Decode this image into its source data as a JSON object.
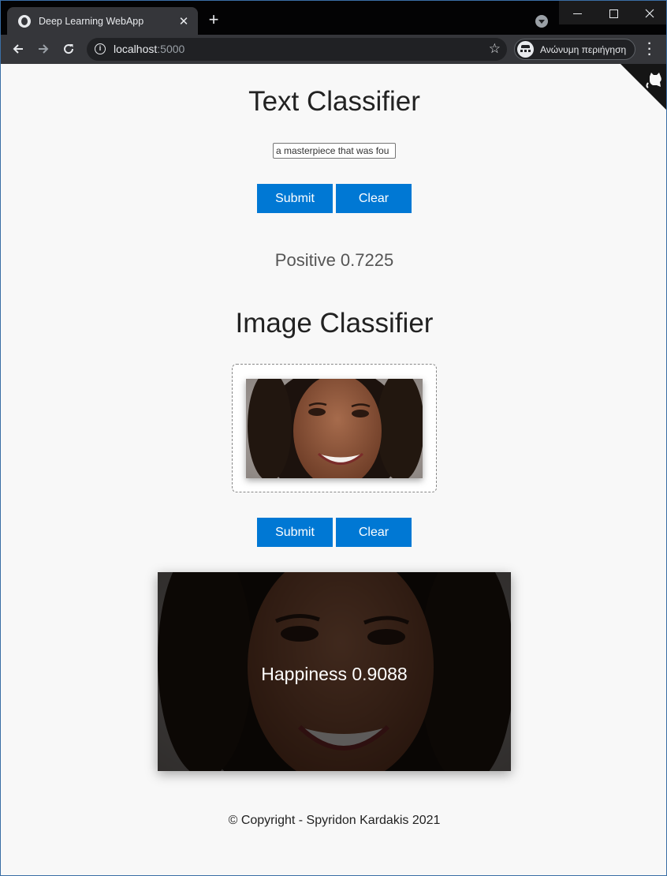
{
  "browser": {
    "tab_title": "Deep Learning WebApp",
    "tab_close": "✕",
    "new_tab": "+",
    "url_host": "localhost",
    "url_port": ":5000",
    "incognito_label": "Ανώνυμη περιήγηση",
    "icons": [
      "globe-icon",
      "close-icon",
      "plus-icon",
      "tab-search-icon",
      "back-arrow-icon",
      "forward-arrow-icon",
      "reload-icon",
      "info-icon",
      "star-icon",
      "incognito-icon",
      "kebab-menu-icon",
      "github-cat-icon"
    ]
  },
  "text_classifier": {
    "title": "Text Classifier",
    "input_value": "a masterpiece that was fou",
    "submit_label": "Submit",
    "clear_label": "Clear",
    "result": "Positive 0.7225"
  },
  "image_classifier": {
    "title": "Image Classifier",
    "submit_label": "Submit",
    "clear_label": "Clear",
    "result": "Happiness 0.9088"
  },
  "footer": {
    "copyright": "© Copyright - Spyridon Kardakis 2021"
  },
  "colors": {
    "accent": "#0078d4",
    "page_bg": "#f8f8f8",
    "chrome_dark": "#35363a"
  }
}
